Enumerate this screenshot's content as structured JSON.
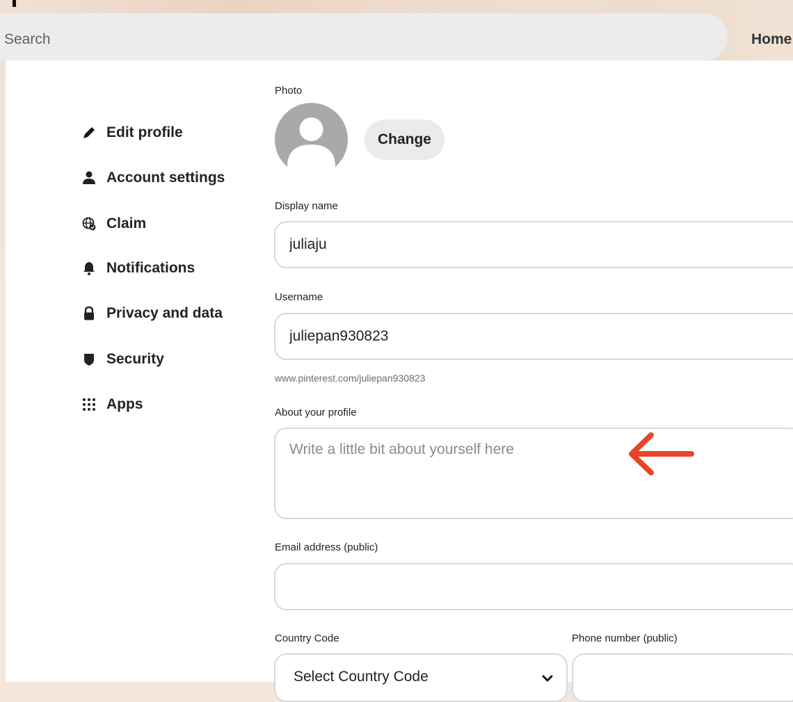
{
  "header": {
    "search_label": "Search",
    "home_label": "Home"
  },
  "sidebar": {
    "items": [
      {
        "label": "Edit profile",
        "icon": "pencil-icon"
      },
      {
        "label": "Account settings",
        "icon": "person-icon"
      },
      {
        "label": "Claim",
        "icon": "globe-check-icon"
      },
      {
        "label": "Notifications",
        "icon": "bell-icon"
      },
      {
        "label": "Privacy and data",
        "icon": "lock-icon"
      },
      {
        "label": "Security",
        "icon": "shield-icon"
      },
      {
        "label": "Apps",
        "icon": "grid-dots-icon"
      }
    ]
  },
  "form": {
    "photo_label": "Photo",
    "change_button": "Change",
    "display_name_label": "Display name",
    "display_name_value": "juliaju",
    "username_label": "Username",
    "username_value": "juliepan930823",
    "profile_url": "www.pinterest.com/juliepan930823",
    "about_label": "About your profile",
    "about_placeholder": "Write a little bit about yourself here",
    "email_label": "Email address (public)",
    "email_value": "",
    "country_code_label": "Country Code",
    "country_code_value": "Select Country Code",
    "phone_label": "Phone number (public)",
    "phone_value": ""
  },
  "colors": {
    "annotation_arrow": "#e8442a",
    "page_background": "#f3e6dc",
    "field_border": "#d8d8d8"
  }
}
